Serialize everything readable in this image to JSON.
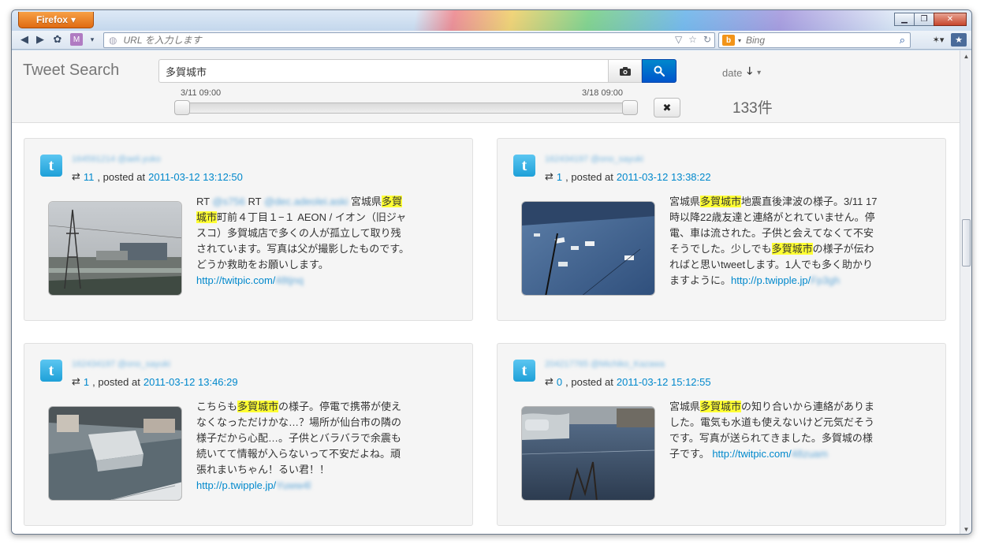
{
  "browser": {
    "app_button": "Firefox",
    "url_placeholder": "URL を入力します",
    "search_engine": "Bing",
    "search_placeholder": "Bing"
  },
  "app": {
    "title": "Tweet Search",
    "query": "多賀城市",
    "sort_label": "date",
    "date_from": "3/11 09:00",
    "date_to": "3/18 09:00",
    "result_count": "133件"
  },
  "tweets": [
    {
      "user": "164591214 @aeli.yuko",
      "retweets": "11",
      "posted_label": ", posted at",
      "date": "2011-03-12 13:12:50",
      "segments": [
        {
          "t": "RT "
        },
        {
          "t": "@s756",
          "c": "blur"
        },
        {
          "t": "  RT "
        },
        {
          "t": "@dec.adeolei.aski",
          "c": "blur"
        },
        {
          "t": "  宮城県"
        },
        {
          "t": "多賀城市",
          "c": "hl"
        },
        {
          "t": "町前４丁目１−１ AEON / イオン（旧ジャスコ）多賀城店で多くの人が孤立して取り残されています。写真は父が撮影したものです。どうか救助をお願いします。　"
        },
        {
          "t": "http://twitpic.com/",
          "c": "link"
        },
        {
          "t": "48tjnq",
          "c": "blur"
        }
      ]
    },
    {
      "user": "162434197 @ono_sayuki",
      "retweets": "1",
      "posted_label": ", posted at",
      "date": "2011-03-12 13:38:22",
      "segments": [
        {
          "t": "宮城県"
        },
        {
          "t": "多賀城市",
          "c": "hl"
        },
        {
          "t": "地震直後津波の様子。3/11 17時以降22歳友達と連絡がとれていません。停電、車は流された。子供と会えてなくて不安そうでした。少しでも"
        },
        {
          "t": "多賀城市",
          "c": "hl"
        },
        {
          "t": "の様子が伝わればと思いtweetします。1人でも多く助かりますように。"
        },
        {
          "t": "http://p.twipple.jp/",
          "c": "link"
        },
        {
          "t": "Fp3gh",
          "c": "blur"
        }
      ]
    },
    {
      "user": "162434197 @ono_sayuki",
      "retweets": "1",
      "posted_label": ", posted at",
      "date": "2011-03-12 13:46:29",
      "segments": [
        {
          "t": "こちらも"
        },
        {
          "t": "多賀城市",
          "c": "hl"
        },
        {
          "t": "の様子。停電で携帯が使えなくなっただけかな…？場所が仙台市の隣の様子だから心配…。子供とバラバラで余震も続いてて情報が入らないって不安だよね。頑張れまいちゃん！るい君！！"
        },
        {
          "t": "http://p.twipple.jp/",
          "c": "link"
        },
        {
          "t": "Yuww4l",
          "c": "blur"
        }
      ]
    },
    {
      "user": "204217765 @Michiko_Kazawa",
      "retweets": "0",
      "posted_label": ", posted at",
      "date": "2011-03-12 15:12:55",
      "segments": [
        {
          "t": "宮城県"
        },
        {
          "t": "多賀城市",
          "c": "hl"
        },
        {
          "t": "の知り合いから連絡がありました。電気も水道も使えないけど元気だそうです。写真が送られてきました。多賀城の様子です。 "
        },
        {
          "t": "http://twitpic.com/",
          "c": "link"
        },
        {
          "t": "48zuam",
          "c": "blur"
        }
      ]
    }
  ],
  "icons": [
    "back-arrow-icon",
    "forward-arrow-icon",
    "camera-icon",
    "search-icon",
    "sort-down-icon",
    "close-icon",
    "retweet-icon",
    "twitter-icon"
  ]
}
